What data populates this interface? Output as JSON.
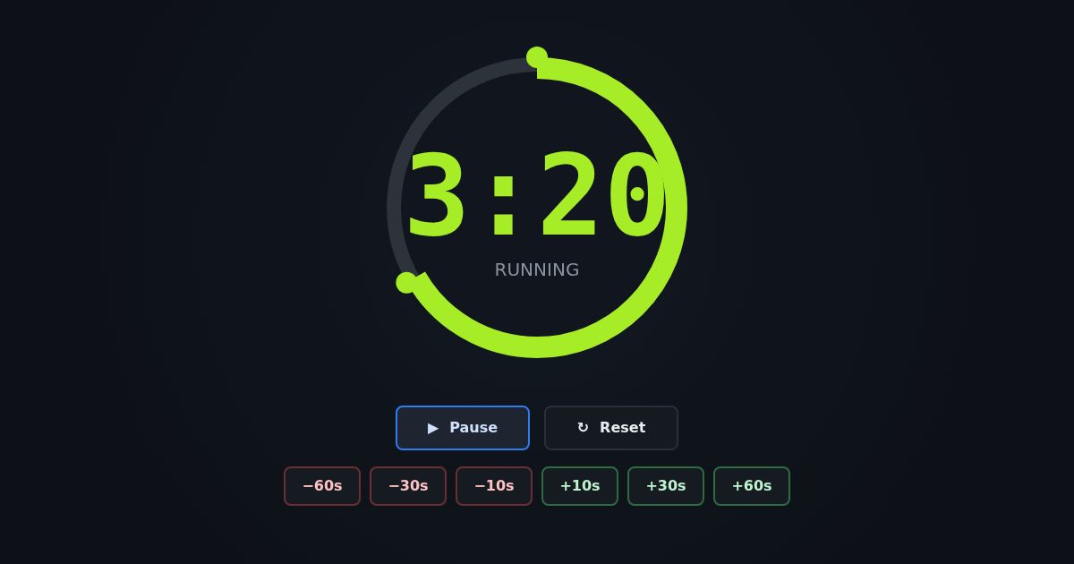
{
  "timer": {
    "time": "3:20",
    "status": "RUNNING",
    "level": 0.667
  },
  "controls": [
    {
      "icon": "▶",
      "label": "Pause",
      "focused": true
    },
    {
      "icon": "↻",
      "label": "Reset",
      "focused": false
    }
  ],
  "adjustments": [
    {
      "kind": "decrease",
      "label": "−60s"
    },
    {
      "kind": "decrease",
      "label": "−30s"
    },
    {
      "kind": "decrease",
      "label": "−10s"
    },
    {
      "kind": "increase",
      "label": "+10s"
    },
    {
      "kind": "increase",
      "label": "+30s"
    },
    {
      "kind": "increase",
      "label": "+60s"
    }
  ]
}
